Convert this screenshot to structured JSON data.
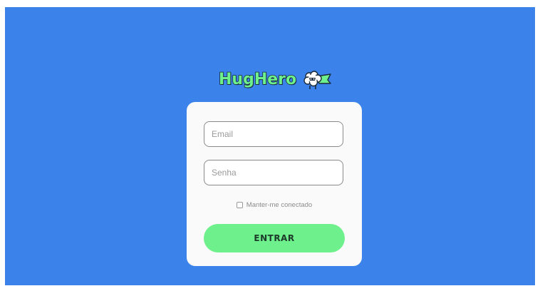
{
  "app": {
    "logo_text": "HugHero",
    "logo_icon": "sheep-hero-icon"
  },
  "login": {
    "email_placeholder": "Email",
    "password_placeholder": "Senha",
    "remember_label": "Manter-me conectado",
    "remember_checked": false,
    "submit_label": "ENTRAR"
  },
  "colors": {
    "background": "#3b83ea",
    "card": "#fafafa",
    "accent": "#6ef08c",
    "text_dark": "#1d3a2a"
  }
}
